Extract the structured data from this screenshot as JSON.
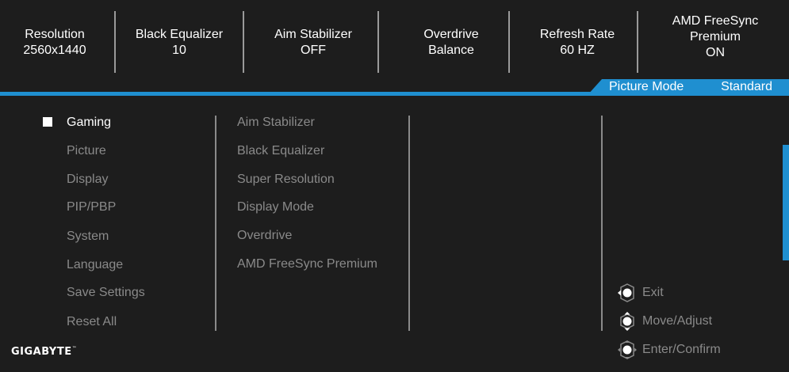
{
  "status_bar": [
    {
      "label": "Resolution",
      "value": "2560x1440"
    },
    {
      "label": "Black Equalizer",
      "value": "10"
    },
    {
      "label": "Aim Stabilizer",
      "value": "OFF"
    },
    {
      "label": "Overdrive",
      "value": "Balance"
    },
    {
      "label": "Refresh Rate",
      "value": "60 HZ"
    },
    {
      "label_line1": "AMD FreeSync",
      "label_line2": "Premium",
      "value": "ON"
    }
  ],
  "picture_mode": {
    "label": "Picture Mode",
    "value": "Standard"
  },
  "main_menu": [
    {
      "label": "Gaming",
      "selected": true
    },
    {
      "label": "Picture"
    },
    {
      "label": "Display"
    },
    {
      "label": "PIP/PBP"
    },
    {
      "label": "System"
    },
    {
      "label": "Language"
    },
    {
      "label": "Save Settings"
    },
    {
      "label": "Reset All"
    }
  ],
  "sub_menu": [
    {
      "label": "Aim Stabilizer"
    },
    {
      "label": "Black Equalizer"
    },
    {
      "label": "Super Resolution"
    },
    {
      "label": "Display Mode"
    },
    {
      "label": "Overdrive"
    },
    {
      "label": "AMD FreeSync Premium"
    }
  ],
  "key_hints": [
    {
      "label": "Exit",
      "icon": "joystick-left-icon"
    },
    {
      "label": "Move/Adjust",
      "icon": "joystick-updown-icon"
    },
    {
      "label": "Enter/Confirm",
      "icon": "joystick-press-icon"
    }
  ],
  "brand": {
    "logo_text": "GIGABYTE",
    "trademark": "™"
  },
  "colors": {
    "accent": "#1f8fd0",
    "background": "#1d1d1d",
    "inactive_text": "#8a8a8a",
    "active_text": "#ffffff"
  }
}
